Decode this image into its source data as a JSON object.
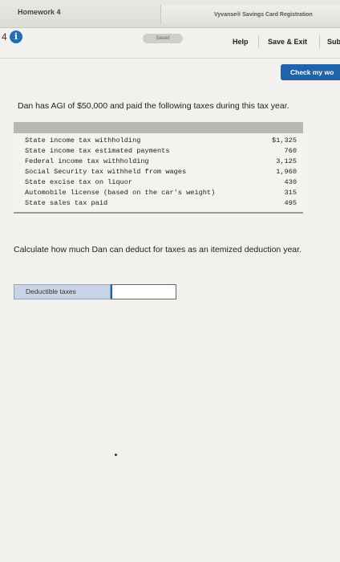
{
  "header": {
    "homework_title": "Homework 4",
    "bookmark_tab": "Vyvanse® Savings Card Registration"
  },
  "question_bar": {
    "question_number": "4",
    "info_icon": "i",
    "saved_status": "Saved",
    "help_label": "Help",
    "save_exit_label": "Save & Exit",
    "submit_label": "Sub"
  },
  "check_button": {
    "label": "Check my wo"
  },
  "question": {
    "prompt": "Dan has AGI of $50,000 and paid the following taxes during this tax year.",
    "instruction": "Calculate how much Dan can deduct for taxes as an itemized deduction year."
  },
  "tax_table": {
    "rows": [
      {
        "label": "State income tax withholding",
        "amount": "$1,325"
      },
      {
        "label": "State income tax estimated payments",
        "amount": "760"
      },
      {
        "label": "Federal income tax withholding",
        "amount": "3,125"
      },
      {
        "label": "Social Security tax withheld from wages",
        "amount": "1,960"
      },
      {
        "label": "State excise tax on liquor",
        "amount": "430"
      },
      {
        "label": "Automobile license (based on the car's weight)",
        "amount": "315"
      },
      {
        "label": "State sales tax paid",
        "amount": "495"
      }
    ]
  },
  "answer": {
    "label": "Deductible taxes",
    "value": ""
  }
}
